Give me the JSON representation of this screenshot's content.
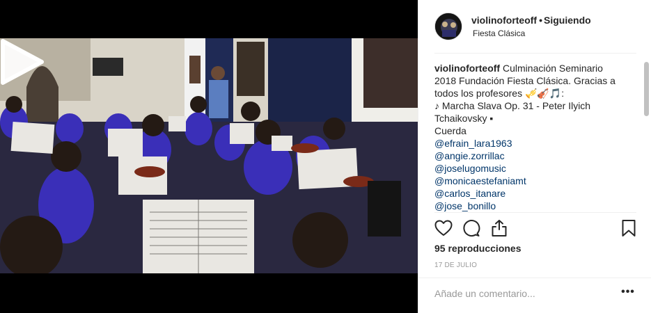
{
  "post": {
    "username": "violinoforteoff",
    "follow_separator": "•",
    "follow_status": "Siguiendo",
    "location": "Fiesta Clásica"
  },
  "media": {
    "type": "video",
    "play_icon": "play-icon"
  },
  "caption": {
    "username": "violinoforteoff",
    "lines": [
      "Culminación Seminario",
      "2018 Fundación Fiesta Clásica. Gracias a",
      "todos los profesores 🎺🎻🎵:",
      "♪ Marcha Slava Op. 31 - Peter Ilyich",
      "Tchaikovsky ▪",
      "Cuerda"
    ],
    "mentions": [
      "@efrain_lara1963",
      "@angie.zorrillac",
      "@joselugomusic",
      "@monicaestefaniamt",
      "@carlos_itanare",
      "@jose_bonillo"
    ]
  },
  "actions": {
    "icons": [
      "heart-icon",
      "comment-icon",
      "share-icon",
      "bookmark-icon"
    ]
  },
  "stats": {
    "views": "95 reproducciones",
    "date": "17 DE JULIO"
  },
  "comment": {
    "placeholder": "Añade un comentario...",
    "more_label": "•••"
  },
  "colors": {
    "link": "#003569",
    "text": "#262626",
    "muted": "#999999",
    "divider": "#efefef"
  }
}
